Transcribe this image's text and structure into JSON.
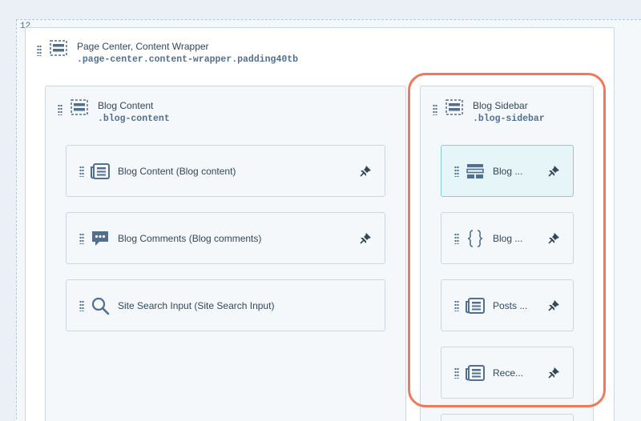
{
  "grid": {
    "column_count": "12"
  },
  "wrapper": {
    "title": "Page Center, Content Wrapper",
    "class_name": ".page-center.content-wrapper.padding40tb"
  },
  "blog_content": {
    "title": "Blog Content",
    "class_name": ".blog-content",
    "modules": [
      {
        "label": "Blog Content (Blog content)",
        "icon": "newspaper-icon"
      },
      {
        "label": "Blog Comments (Blog comments)",
        "icon": "comment-bubble-icon"
      },
      {
        "label": "Site Search Input (Site Search Input)",
        "icon": "search-icon"
      }
    ]
  },
  "blog_sidebar": {
    "title": "Blog Sidebar",
    "class_name": ".blog-sidebar",
    "modules": [
      {
        "label": "Blog ...",
        "icon": "layout-rows-icon",
        "active": true
      },
      {
        "label": "Blog ...",
        "icon": "curly-braces-icon"
      },
      {
        "label": "Posts ...",
        "icon": "newspaper-icon"
      },
      {
        "label": "Rece...",
        "icon": "newspaper-icon"
      }
    ]
  },
  "colors": {
    "highlight": "#f2785c",
    "active_module_bg": "#e5f5f8",
    "active_module_border": "#7fd1de",
    "icon": "#516f90"
  }
}
